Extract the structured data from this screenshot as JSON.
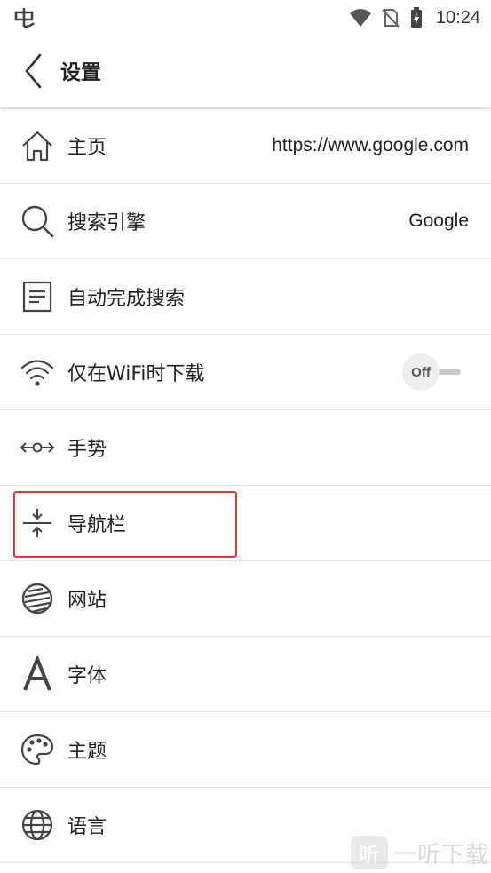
{
  "status_bar": {
    "time": "10:24"
  },
  "app_bar": {
    "title": "设置"
  },
  "settings": {
    "items": [
      {
        "label": "主页",
        "value": "https://www.google.com",
        "icon": "home-icon"
      },
      {
        "label": "搜索引擎",
        "value": "Google",
        "icon": "search-icon"
      },
      {
        "label": "自动完成搜索",
        "icon": "document-lines-icon"
      },
      {
        "label": "仅在WiFi时下载",
        "icon": "wifi-icon",
        "toggle": "Off"
      },
      {
        "label": "手势",
        "icon": "gesture-arrows-icon"
      },
      {
        "label": "导航栏",
        "icon": "collapse-vertical-icon"
      },
      {
        "label": "网站",
        "icon": "website-globe-stripes-icon"
      },
      {
        "label": "字体",
        "icon": "font-letter-a-icon"
      },
      {
        "label": "主题",
        "icon": "palette-icon"
      },
      {
        "label": "语言",
        "icon": "globe-icon"
      }
    ]
  },
  "highlight_color": "#e53935",
  "watermark": {
    "logo": "听",
    "text": "一听下载"
  }
}
